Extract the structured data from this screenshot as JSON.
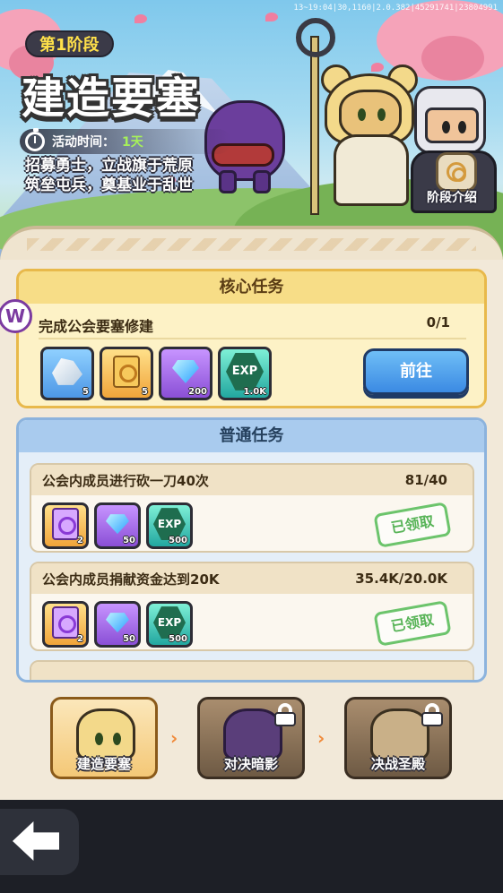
{
  "debug_text": "13~19:04|30,1160|2.0.382|45291741|23804991",
  "banner": {
    "stage_label": "第1阶段",
    "title": "建造要塞",
    "time_label": "活动时间：",
    "time_value": "1天",
    "desc_line1": "招募勇士，立战旗于荒原",
    "desc_line2": "筑垒屯兵，奠基业于乱世",
    "intro_label": "阶段介绍"
  },
  "core": {
    "header": "核心任务",
    "task": "完成公会要塞修建",
    "progress": "0/1",
    "go_label": "前往",
    "rewards": [
      {
        "icon": "crystal-icon",
        "qty": "5"
      },
      {
        "icon": "scroll-icon",
        "qty": "5"
      },
      {
        "icon": "diamond-icon",
        "qty": "200"
      },
      {
        "icon": "exp-icon",
        "label": "EXP",
        "qty": "1.0K"
      }
    ]
  },
  "normal": {
    "header": "普通任务",
    "tasks": [
      {
        "title": "公会内成员进行砍一刀40次",
        "progress": "81/40",
        "status": "已领取",
        "rewards": [
          {
            "icon": "violet-scroll-icon",
            "qty": "2"
          },
          {
            "icon": "diamond-icon",
            "qty": "50"
          },
          {
            "icon": "exp-icon",
            "label": "EXP",
            "qty": "500"
          }
        ]
      },
      {
        "title": "公会内成员捐献资金达到20K",
        "progress": "35.4K/20.0K",
        "status": "已领取",
        "rewards": [
          {
            "icon": "violet-scroll-icon",
            "qty": "2"
          },
          {
            "icon": "diamond-icon",
            "qty": "50"
          },
          {
            "icon": "exp-icon",
            "label": "EXP",
            "qty": "500"
          }
        ]
      }
    ]
  },
  "stages": [
    {
      "label": "建造要塞",
      "locked": false
    },
    {
      "label": "对决暗影",
      "locked": true
    },
    {
      "label": "决战圣殿",
      "locked": true
    }
  ],
  "colors": {
    "accent_gold": "#e8b94b",
    "accent_blue": "#3b8ae3",
    "claimed_green": "#58b458"
  }
}
